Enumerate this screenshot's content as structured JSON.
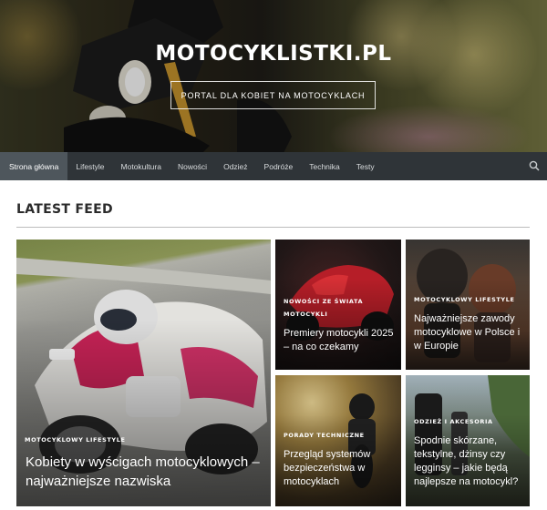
{
  "site": {
    "title": "MOTOCYKLISTKI.PL",
    "tagline": "PORTAL DLA KOBIET NA MOTOCYKLACH"
  },
  "nav": {
    "items": [
      {
        "label": "Strona główna",
        "active": true
      },
      {
        "label": "Lifestyle"
      },
      {
        "label": "Motokultura"
      },
      {
        "label": "Nowości"
      },
      {
        "label": "Odzież"
      },
      {
        "label": "Podróże"
      },
      {
        "label": "Technika"
      },
      {
        "label": "Testy"
      }
    ],
    "search_icon": "search-icon"
  },
  "feed": {
    "heading": "LATEST FEED",
    "posts": [
      {
        "categories": [
          "MOTOCYKLOWY LIFESTYLE"
        ],
        "title": "Kobiety w wyścigach motocyklowych – najważniejsze nazwiska"
      },
      {
        "categories": [
          "NOWOŚCI ZE ŚWIATA MOTOCYKLI"
        ],
        "title": "Premiery motocykli 2025 – na co czekamy"
      },
      {
        "categories": [
          "MOTOCYKLOWY LIFESTYLE"
        ],
        "title": "Najważniejsze zawody motocyklowe w Polsce i w Europie"
      },
      {
        "categories": [
          "PORADY TECHNICZNE"
        ],
        "title": "Przegląd systemów bezpieczeństwa w motocyklach"
      },
      {
        "categories": [
          "ODZIEŻ I AKCESORIA"
        ],
        "title": "Spodnie skórzane, tekstylne, dżinsy czy legginsy – jakie będą najlepsze na motocykl?"
      }
    ]
  }
}
